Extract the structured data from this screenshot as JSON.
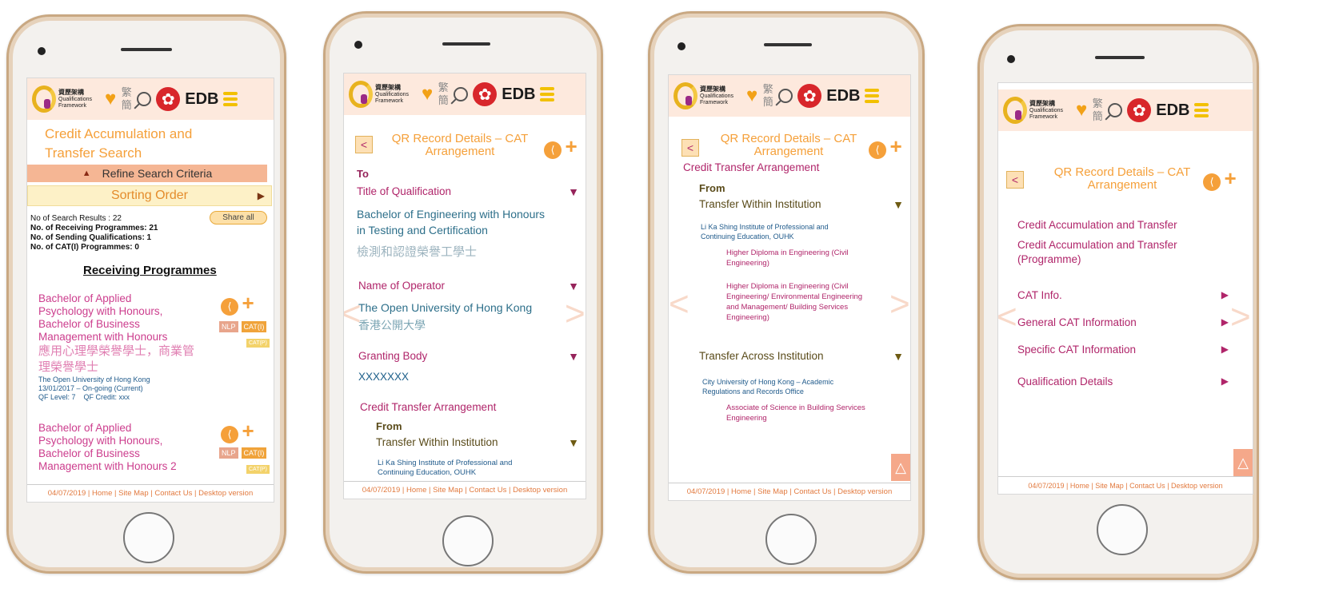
{
  "header": {
    "logo_text_cn": "資歷架構",
    "logo_text_en": "Qualifications Framework",
    "lang_trad": "繁",
    "lang_simp": "簡",
    "edb": "EDB"
  },
  "footer": {
    "date": "04/07/2019",
    "home": "Home",
    "sitemap": "Site Map",
    "contact": "Contact Us",
    "desktop": "Desktop version",
    "sep": "|"
  },
  "screen1": {
    "title_line1": "Credit Accumulation and",
    "title_line2": "Transfer Search",
    "refine": "Refine Search Criteria",
    "sorting": "Sorting Order",
    "share_all": "Share all",
    "stats": [
      "No of Search Results : 22",
      "No. of Receiving Programmes: 21",
      "No. of Sending Qualifications: 1",
      "No. of CAT(I) Programmes: 0"
    ],
    "section_title": "Receiving Programmes",
    "results": [
      {
        "title_lines": [
          "Bachelor of Applied",
          "Psychology with Honours,",
          "Bachelor of Business",
          "Management with Honours"
        ],
        "cn_lines": [
          "應用心理學榮譽學士，商業管",
          "理榮譽學士"
        ],
        "operator": "The Open University of Hong Kong",
        "period": "13/01/2017 – On-going (Current)",
        "qf_level": "QF Level: 7",
        "qf_credit": "QF Credit: xxx",
        "tags": [
          "NLP",
          "CAT(I)",
          "CAT(P)"
        ]
      },
      {
        "title_lines": [
          "Bachelor of Applied",
          "Psychology with Honours,",
          "Bachelor of Business",
          "Management with Honours 2"
        ],
        "tags": [
          "NLP",
          "CAT(I)",
          "CAT(P)"
        ]
      }
    ]
  },
  "screen2": {
    "title_line1": "QR Record Details – CAT",
    "title_line2": "Arrangement",
    "to_label": "To",
    "title_of_qual_label": "Title of Qualification",
    "qual_en_line1": "Bachelor of Engineering with Honours",
    "qual_en_line2": "in Testing and Certification",
    "qual_cn": "檢測和認證榮譽工學士",
    "operator_label": "Name of Operator",
    "operator_en": "The Open University of Hong Kong",
    "operator_cn": "香港公開大學",
    "granting_label": "Granting Body",
    "granting_value": "XXXXXXX",
    "cta_label": "Credit Transfer Arrangement",
    "from_label": "From",
    "within_label": "Transfer Within Institution",
    "inst_line1": "Li Ka Shing Institute of Professional and",
    "inst_line2": "Continuing Education, OUHK"
  },
  "screen3": {
    "title_line1": "QR Record Details – CAT",
    "title_line2": "Arrangement",
    "cta_label": "Credit Transfer Arrangement",
    "from_label": "From",
    "within_label": "Transfer Within Institution",
    "inst_line1": "Li Ka Shing Institute of Professional and",
    "inst_line2": "Continuing Education, OUHK",
    "prog1_line1": "Higher Diploma in Engineering (Civil",
    "prog1_line2": "Engineering)",
    "prog2_line1": "Higher Diploma in Engineering (Civil",
    "prog2_line2": "Engineering/ Environmental Engineering",
    "prog2_line3": "and Management/ Building Services",
    "prog2_line4": "Engineering)",
    "across_label": "Transfer Across Institution",
    "across_inst_line1": "City University of Hong Kong – Academic",
    "across_inst_line2": "Regulations and Records Office",
    "across_prog_line1": "Associate of Science in Building Services",
    "across_prog_line2": "Engineering"
  },
  "screen4": {
    "title_line1": "QR Record Details – CAT",
    "title_line2": "Arrangement",
    "cat_title": "Credit Accumulation and Transfer",
    "cat_prog_line1": "Credit Accumulation and Transfer",
    "cat_prog_line2": "(Programme)",
    "menu": [
      "CAT Info.",
      "General CAT Information",
      "Specific CAT Information",
      "Qualification Details"
    ]
  },
  "colors": {
    "orange": "#f5a03a",
    "magenta": "#b0256a",
    "teal": "#2d6f8a",
    "header_bg": "#fde9dd"
  }
}
